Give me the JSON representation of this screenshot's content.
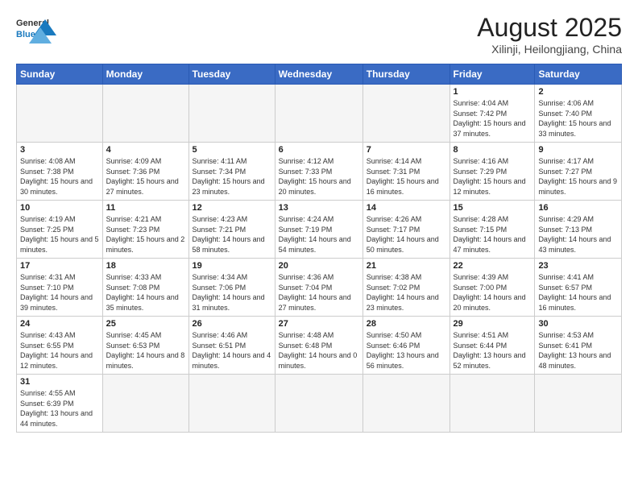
{
  "header": {
    "logo_general": "General",
    "logo_blue": "Blue",
    "month_year": "August 2025",
    "location": "Xilinji, Heilongjiang, China"
  },
  "weekdays": [
    "Sunday",
    "Monday",
    "Tuesday",
    "Wednesday",
    "Thursday",
    "Friday",
    "Saturday"
  ],
  "weeks": [
    [
      {
        "day": "",
        "info": ""
      },
      {
        "day": "",
        "info": ""
      },
      {
        "day": "",
        "info": ""
      },
      {
        "day": "",
        "info": ""
      },
      {
        "day": "",
        "info": ""
      },
      {
        "day": "1",
        "info": "Sunrise: 4:04 AM\nSunset: 7:42 PM\nDaylight: 15 hours and 37 minutes."
      },
      {
        "day": "2",
        "info": "Sunrise: 4:06 AM\nSunset: 7:40 PM\nDaylight: 15 hours and 33 minutes."
      }
    ],
    [
      {
        "day": "3",
        "info": "Sunrise: 4:08 AM\nSunset: 7:38 PM\nDaylight: 15 hours and 30 minutes."
      },
      {
        "day": "4",
        "info": "Sunrise: 4:09 AM\nSunset: 7:36 PM\nDaylight: 15 hours and 27 minutes."
      },
      {
        "day": "5",
        "info": "Sunrise: 4:11 AM\nSunset: 7:34 PM\nDaylight: 15 hours and 23 minutes."
      },
      {
        "day": "6",
        "info": "Sunrise: 4:12 AM\nSunset: 7:33 PM\nDaylight: 15 hours and 20 minutes."
      },
      {
        "day": "7",
        "info": "Sunrise: 4:14 AM\nSunset: 7:31 PM\nDaylight: 15 hours and 16 minutes."
      },
      {
        "day": "8",
        "info": "Sunrise: 4:16 AM\nSunset: 7:29 PM\nDaylight: 15 hours and 12 minutes."
      },
      {
        "day": "9",
        "info": "Sunrise: 4:17 AM\nSunset: 7:27 PM\nDaylight: 15 hours and 9 minutes."
      }
    ],
    [
      {
        "day": "10",
        "info": "Sunrise: 4:19 AM\nSunset: 7:25 PM\nDaylight: 15 hours and 5 minutes."
      },
      {
        "day": "11",
        "info": "Sunrise: 4:21 AM\nSunset: 7:23 PM\nDaylight: 15 hours and 2 minutes."
      },
      {
        "day": "12",
        "info": "Sunrise: 4:23 AM\nSunset: 7:21 PM\nDaylight: 14 hours and 58 minutes."
      },
      {
        "day": "13",
        "info": "Sunrise: 4:24 AM\nSunset: 7:19 PM\nDaylight: 14 hours and 54 minutes."
      },
      {
        "day": "14",
        "info": "Sunrise: 4:26 AM\nSunset: 7:17 PM\nDaylight: 14 hours and 50 minutes."
      },
      {
        "day": "15",
        "info": "Sunrise: 4:28 AM\nSunset: 7:15 PM\nDaylight: 14 hours and 47 minutes."
      },
      {
        "day": "16",
        "info": "Sunrise: 4:29 AM\nSunset: 7:13 PM\nDaylight: 14 hours and 43 minutes."
      }
    ],
    [
      {
        "day": "17",
        "info": "Sunrise: 4:31 AM\nSunset: 7:10 PM\nDaylight: 14 hours and 39 minutes."
      },
      {
        "day": "18",
        "info": "Sunrise: 4:33 AM\nSunset: 7:08 PM\nDaylight: 14 hours and 35 minutes."
      },
      {
        "day": "19",
        "info": "Sunrise: 4:34 AM\nSunset: 7:06 PM\nDaylight: 14 hours and 31 minutes."
      },
      {
        "day": "20",
        "info": "Sunrise: 4:36 AM\nSunset: 7:04 PM\nDaylight: 14 hours and 27 minutes."
      },
      {
        "day": "21",
        "info": "Sunrise: 4:38 AM\nSunset: 7:02 PM\nDaylight: 14 hours and 23 minutes."
      },
      {
        "day": "22",
        "info": "Sunrise: 4:39 AM\nSunset: 7:00 PM\nDaylight: 14 hours and 20 minutes."
      },
      {
        "day": "23",
        "info": "Sunrise: 4:41 AM\nSunset: 6:57 PM\nDaylight: 14 hours and 16 minutes."
      }
    ],
    [
      {
        "day": "24",
        "info": "Sunrise: 4:43 AM\nSunset: 6:55 PM\nDaylight: 14 hours and 12 minutes."
      },
      {
        "day": "25",
        "info": "Sunrise: 4:45 AM\nSunset: 6:53 PM\nDaylight: 14 hours and 8 minutes."
      },
      {
        "day": "26",
        "info": "Sunrise: 4:46 AM\nSunset: 6:51 PM\nDaylight: 14 hours and 4 minutes."
      },
      {
        "day": "27",
        "info": "Sunrise: 4:48 AM\nSunset: 6:48 PM\nDaylight: 14 hours and 0 minutes."
      },
      {
        "day": "28",
        "info": "Sunrise: 4:50 AM\nSunset: 6:46 PM\nDaylight: 13 hours and 56 minutes."
      },
      {
        "day": "29",
        "info": "Sunrise: 4:51 AM\nSunset: 6:44 PM\nDaylight: 13 hours and 52 minutes."
      },
      {
        "day": "30",
        "info": "Sunrise: 4:53 AM\nSunset: 6:41 PM\nDaylight: 13 hours and 48 minutes."
      }
    ],
    [
      {
        "day": "31",
        "info": "Sunrise: 4:55 AM\nSunset: 6:39 PM\nDaylight: 13 hours and 44 minutes."
      },
      {
        "day": "",
        "info": ""
      },
      {
        "day": "",
        "info": ""
      },
      {
        "day": "",
        "info": ""
      },
      {
        "day": "",
        "info": ""
      },
      {
        "day": "",
        "info": ""
      },
      {
        "day": "",
        "info": ""
      }
    ]
  ]
}
